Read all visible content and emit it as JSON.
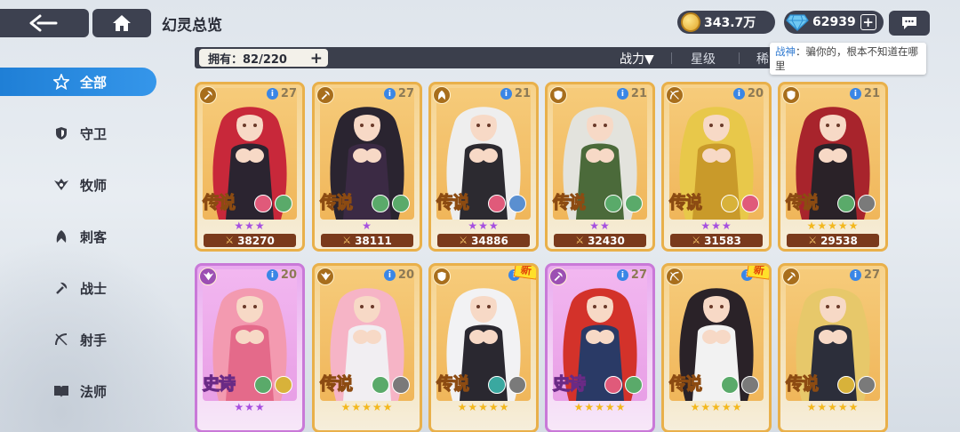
{
  "header": {
    "title": "幻灵总览",
    "gold": "343.7万",
    "gems": "62939"
  },
  "toolbar": {
    "owned": "拥有：82/220",
    "sort_power": "战力▼",
    "sort_star": "星级",
    "sort_rarity": "稀"
  },
  "tooltip": {
    "name": "战神",
    "sep": "：",
    "text": "骗你的，根本不知道在哪里"
  },
  "sidebar": {
    "items": [
      {
        "label": "全部",
        "icon": "all-star-icon",
        "active": true
      },
      {
        "label": "守卫",
        "icon": "shield-icon",
        "active": false
      },
      {
        "label": "牧师",
        "icon": "wings-icon",
        "active": false
      },
      {
        "label": "刺客",
        "icon": "dagger-icon",
        "active": false
      },
      {
        "label": "战士",
        "icon": "axe-icon",
        "active": false
      },
      {
        "label": "射手",
        "icon": "bow-icon",
        "active": false
      },
      {
        "label": "法师",
        "icon": "book-icon",
        "active": false
      }
    ]
  },
  "colors": {
    "accent_blue": "#2a88e2",
    "legend_border": "#e9b04a",
    "epic_border": "#c979d8",
    "power_bg": "#7a3a1c"
  },
  "cards": [
    {
      "rarity": "传说",
      "level": "27",
      "stars": "★★★",
      "star_color": "purple",
      "power": "38270",
      "new": false,
      "type": "legend",
      "class_icon": "axe-icon",
      "elems": [
        "#e05a7a",
        "#5aaa6a"
      ]
    },
    {
      "rarity": "传说",
      "level": "27",
      "stars": "★",
      "star_color": "purple",
      "power": "38111",
      "new": false,
      "type": "legend",
      "class_icon": "axe-icon",
      "elems": [
        "#5aaa6a",
        "#5aaa6a"
      ]
    },
    {
      "rarity": "传说",
      "level": "21",
      "stars": "★★★",
      "star_color": "purple",
      "power": "34886",
      "new": false,
      "type": "legend",
      "class_icon": "dagger-icon",
      "elems": [
        "#e05a7a",
        "#5a8fd0"
      ]
    },
    {
      "rarity": "传说",
      "level": "21",
      "stars": "★★",
      "star_color": "purple",
      "power": "32430",
      "new": false,
      "type": "legend",
      "class_icon": "shield-icon",
      "elems": [
        "#5aaa6a",
        "#5aaa6a"
      ]
    },
    {
      "rarity": "传说",
      "level": "20",
      "stars": "★★★",
      "star_color": "purple",
      "power": "31583",
      "new": false,
      "type": "legend",
      "class_icon": "bow-icon",
      "elems": [
        "#d8b23a",
        "#e05a7a"
      ]
    },
    {
      "rarity": "传说",
      "level": "21",
      "stars": "★★★★★",
      "star_color": "gold",
      "power": "29538",
      "new": false,
      "type": "legend",
      "class_icon": "shield-icon",
      "elems": [
        "#5aaa6a",
        "#7a7a7a"
      ]
    },
    {
      "rarity": "史诗",
      "level": "20",
      "stars": "★★★",
      "star_color": "purple",
      "power": "",
      "new": false,
      "type": "epic",
      "class_icon": "wings-icon",
      "elems": [
        "#5aaa6a",
        "#d8b23a"
      ]
    },
    {
      "rarity": "传说",
      "level": "20",
      "stars": "★★★★★",
      "star_color": "gold",
      "power": "",
      "new": false,
      "type": "legend",
      "class_icon": "wings-icon",
      "elems": [
        "#5aaa6a",
        "#7a7a7a"
      ]
    },
    {
      "rarity": "传说",
      "level": "2",
      "stars": "★★★★★",
      "star_color": "gold",
      "power": "",
      "new": true,
      "type": "legend",
      "class_icon": "shield-icon",
      "elems": [
        "#3aa8a0",
        "#7a7a7a"
      ]
    },
    {
      "rarity": "史诗",
      "level": "27",
      "stars": "★★★★★",
      "star_color": "gold",
      "power": "",
      "new": false,
      "type": "epic",
      "class_icon": "axe-icon",
      "elems": [
        "#e05a7a",
        "#5aaa6a"
      ]
    },
    {
      "rarity": "传说",
      "level": "2",
      "stars": "★★★★★",
      "star_color": "gold",
      "power": "",
      "new": true,
      "type": "legend",
      "class_icon": "bow-icon",
      "elems": [
        "#5aaa6a",
        "#7a7a7a"
      ]
    },
    {
      "rarity": "传说",
      "level": "27",
      "stars": "★★★★★",
      "star_color": "gold",
      "power": "",
      "new": false,
      "type": "legend",
      "class_icon": "axe-icon",
      "elems": [
        "#d8b23a",
        "#7a7a7a"
      ]
    }
  ]
}
